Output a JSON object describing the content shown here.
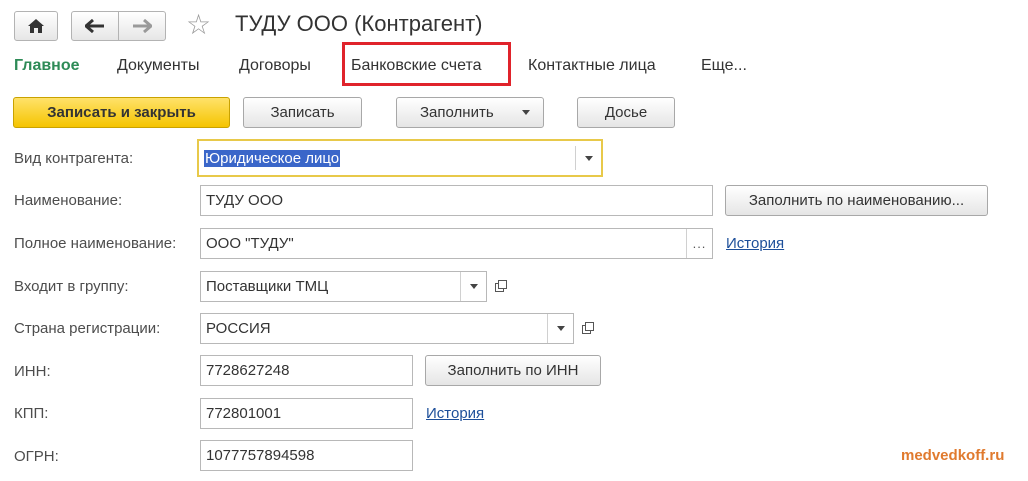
{
  "window": {
    "title": "ТУДУ ООО (Контрагент)",
    "icons": {
      "home": "home-icon",
      "back": "arrow-left-icon",
      "forward": "arrow-right-icon",
      "favorite": "star-icon"
    }
  },
  "tabs": [
    {
      "label": "Главное",
      "active": true
    },
    {
      "label": "Документы"
    },
    {
      "label": "Договоры"
    },
    {
      "label": "Банковские счета",
      "highlighted": true
    },
    {
      "label": "Контактные лица"
    },
    {
      "label": "Еще..."
    }
  ],
  "toolbar": {
    "save_close": "Записать и закрыть",
    "save": "Записать",
    "fill": "Заполнить",
    "dossier": "Досье"
  },
  "form": {
    "kind": {
      "label": "Вид контрагента:",
      "value": "Юридическое лицо"
    },
    "name": {
      "label": "Наименование:",
      "value": "ТУДУ ООО",
      "button": "Заполнить по наименованию..."
    },
    "full_name": {
      "label": "Полное наименование:",
      "value": "ООО \"ТУДУ\"",
      "ellipsis": "...",
      "link": "История"
    },
    "group": {
      "label": "Входит в группу:",
      "value": "Поставщики ТМЦ"
    },
    "country": {
      "label": "Страна регистрации:",
      "value": "РОССИЯ"
    },
    "inn": {
      "label": "ИНН:",
      "value": "7728627248",
      "button": "Заполнить по ИНН"
    },
    "kpp": {
      "label": "КПП:",
      "value": "772801001",
      "link": "История"
    },
    "ogrn": {
      "label": "ОГРН:",
      "value": "1077757894598"
    }
  },
  "watermark": "medvedkoff.ru",
  "colors": {
    "accent_green": "#2e8b57",
    "primary_yellow": "#f5c400",
    "highlight_red": "#e0232b",
    "link_blue": "#1d4f9a",
    "watermark_orange": "#e07a2e"
  }
}
